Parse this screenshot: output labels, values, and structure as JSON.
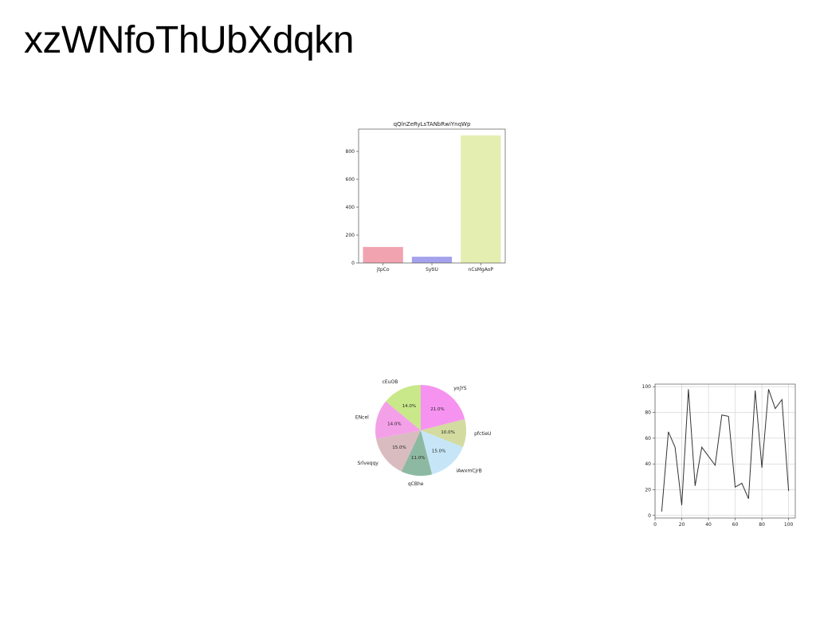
{
  "page": {
    "title": "xzWNfoThUbXdqkn"
  },
  "chart_data": [
    {
      "type": "bar",
      "title": "qQlnZeRyLsTANbRwiYnqWp",
      "categories": [
        "jtpCo",
        "SytIU",
        "nCsMgAoP"
      ],
      "values": [
        115,
        45,
        915
      ],
      "colors": [
        "#f2a3b0",
        "#a4a2ec",
        "#e4eeb0"
      ],
      "ylim": [
        0,
        960
      ],
      "yticks": [
        0,
        200,
        400,
        600,
        800
      ],
      "grid": false
    },
    {
      "type": "pie",
      "labels": [
        "yojYS",
        "pfctieU",
        "iAwxmCjrB",
        "qCBhe",
        "Srlveqqy",
        "ENcel",
        "cEuOB"
      ],
      "values": [
        21.0,
        10.0,
        15.0,
        11.0,
        15.0,
        14.0,
        14.0
      ],
      "autopct": [
        "21.0%",
        "10.0%",
        "15.0%",
        "11.0%",
        "15.0%",
        "14.0%",
        "14.0%"
      ],
      "colors": [
        "#f693f0",
        "#d3dba0",
        "#c6e6f8",
        "#8db9a2",
        "#d9bcc0",
        "#f4a0e8",
        "#c9e88a"
      ]
    },
    {
      "type": "line",
      "x": [
        5,
        10,
        15,
        20,
        25,
        30,
        35,
        40,
        45,
        50,
        55,
        60,
        65,
        70,
        75,
        80,
        85,
        90,
        95,
        100
      ],
      "y": [
        3,
        65,
        53,
        8,
        98,
        23,
        53,
        46,
        39,
        78,
        77,
        22,
        25,
        13,
        97,
        37,
        98,
        83,
        90,
        19
      ],
      "xlim": [
        0,
        105
      ],
      "ylim": [
        -2,
        102
      ],
      "xticks": [
        0,
        20,
        40,
        60,
        80,
        100
      ],
      "yticks": [
        0,
        20,
        40,
        60,
        80,
        100
      ],
      "color": "#333333",
      "grid": true
    }
  ]
}
